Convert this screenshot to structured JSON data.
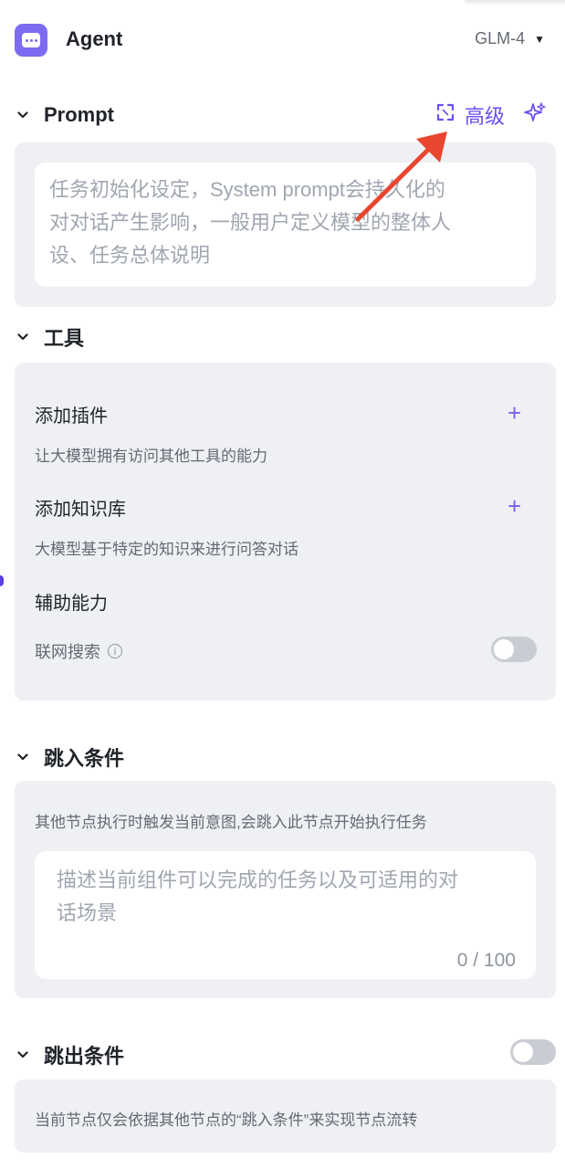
{
  "header": {
    "title": "Agent",
    "model": "GLM-4"
  },
  "prompt_section": {
    "title": "Prompt",
    "advanced_label": "高级",
    "placeholder_lines": [
      "任务初始化设定，System prompt会持久化的",
      "对对话产生影响，一般用户定义模型的整体人",
      "设、任务总体说明"
    ]
  },
  "tools_section": {
    "title": "工具",
    "add_plugin": {
      "title": "添加插件",
      "desc": "让大模型拥有访问其他工具的能力"
    },
    "add_knowledge": {
      "title": "添加知识库",
      "desc": "大模型基于特定的知识来进行问答对话"
    },
    "assist": {
      "title": "辅助能力",
      "web_search_label": "联网搜索",
      "web_search_enabled": false
    }
  },
  "enter_condition": {
    "title": "跳入条件",
    "description": "其他节点执行时触发当前意图,会跳入此节点开始执行任务",
    "placeholder_lines": [
      "描述当前组件可以完成的任务以及可适用的对",
      "话场景"
    ],
    "counter": "0 / 100"
  },
  "exit_condition": {
    "title": "跳出条件",
    "enabled": false,
    "description": "当前节点仅会依据其他节点的“跳入条件”来实现节点流转"
  },
  "colors": {
    "accent": "#6e4ff0",
    "arrow": "#e8462f",
    "card_bg": "#eff0f4"
  }
}
